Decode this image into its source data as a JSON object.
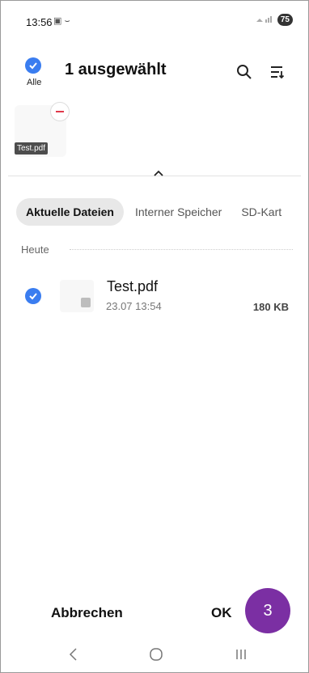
{
  "status_bar": {
    "time": "13:56",
    "icons": "▣ ⌣",
    "battery": "75"
  },
  "header": {
    "select_all_label": "Alle",
    "title": "1 ausgewählt"
  },
  "selected_items": [
    {
      "label": "Test.pdf"
    }
  ],
  "tabs": [
    {
      "label": "Aktuelle Dateien",
      "active": true
    },
    {
      "label": "Interner Speicher",
      "active": false
    },
    {
      "label": "SD-Kart",
      "active": false
    }
  ],
  "section": {
    "label": "Heute"
  },
  "files": [
    {
      "name": "Test.pdf",
      "date": "23.07 13:54",
      "size": "180 KB",
      "selected": true
    }
  ],
  "actions": {
    "cancel_label": "Abbrechen",
    "ok_label": "OK"
  },
  "step_badge": {
    "number": "3"
  },
  "colors": {
    "accent": "#3a7df0",
    "badge": "#7b2fa3",
    "remove": "#e0394b"
  }
}
